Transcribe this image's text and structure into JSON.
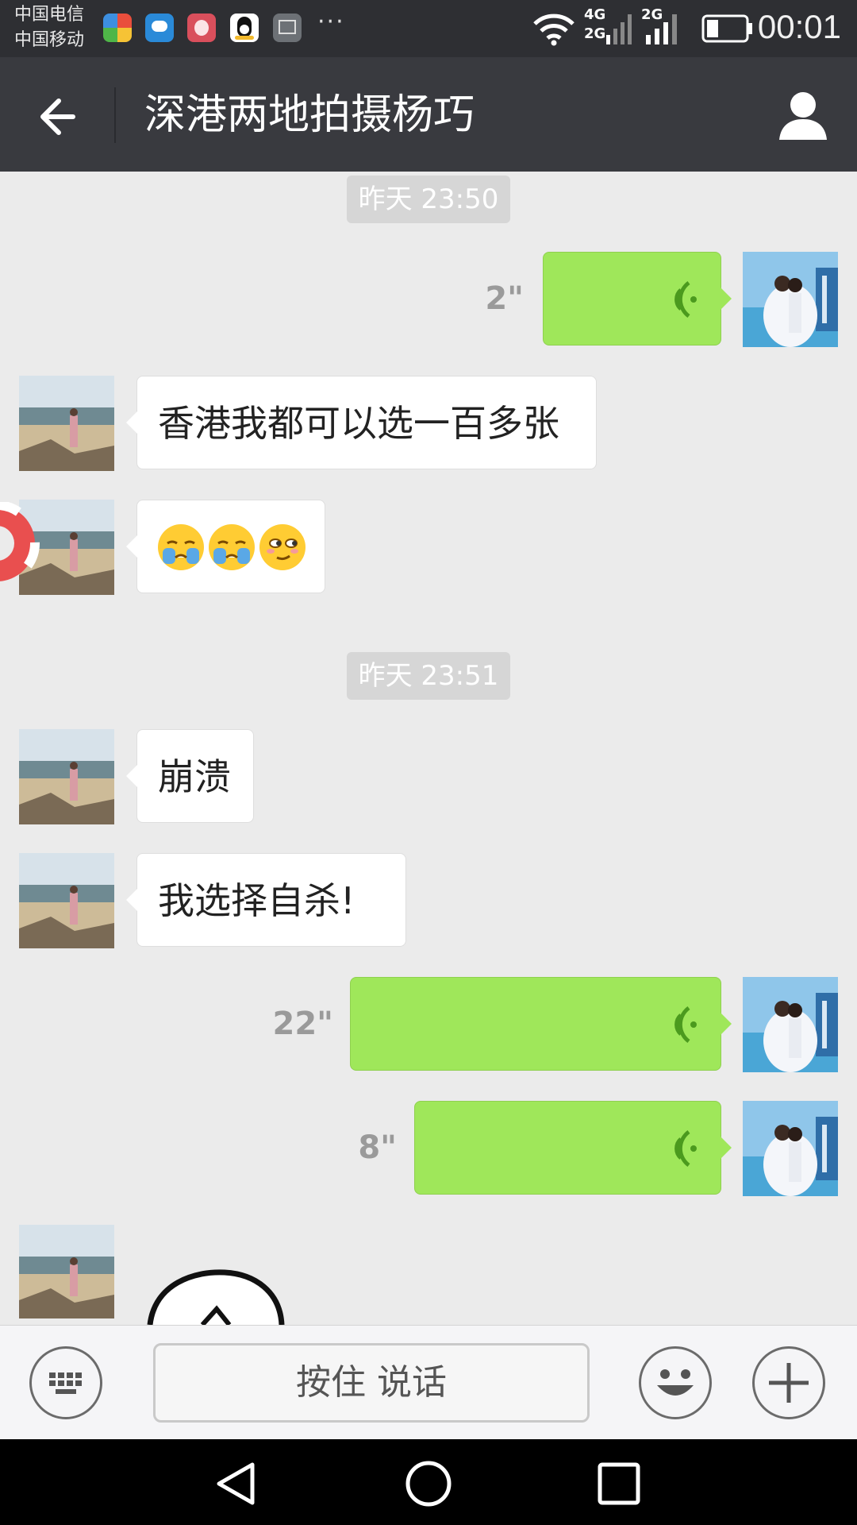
{
  "status_bar": {
    "carrier_1": "中国电信",
    "carrier_2": "中国移动",
    "overflow": "···",
    "net_label_top": "4G",
    "net_label_bottom": "2G",
    "net_label_sim2": "2G",
    "time": "00:01",
    "notification_icons": [
      "colorful-app-icon",
      "chat-bubble-icon",
      "pony-app-icon",
      "qq-penguin-icon",
      "gallery-icon"
    ]
  },
  "header": {
    "title": "深港两地拍摄杨巧",
    "back_icon": "arrow-left-icon",
    "profile_icon": "person-icon"
  },
  "messages": {
    "timestamp_1": "昨天 23:50",
    "voice_1_duration": "2\"",
    "text_1": "香港我都可以选一百多张",
    "timestamp_2": "昨天 23:51",
    "text_2": "崩溃",
    "text_3": "我选择自杀!",
    "voice_2_duration": "22\"",
    "voice_3_duration": "8\""
  },
  "input_bar": {
    "hold_to_talk": "按住 说话",
    "keyboard_icon": "keyboard-icon",
    "emoji_icon": "smiley-icon",
    "plus_icon": "plus-icon"
  },
  "colors": {
    "header_bg": "#393a3f",
    "chat_bg": "#ebebeb",
    "outgoing_bubble": "#9fe75a",
    "incoming_bubble": "#ffffff",
    "voice_wave": "#4b9a1e"
  }
}
